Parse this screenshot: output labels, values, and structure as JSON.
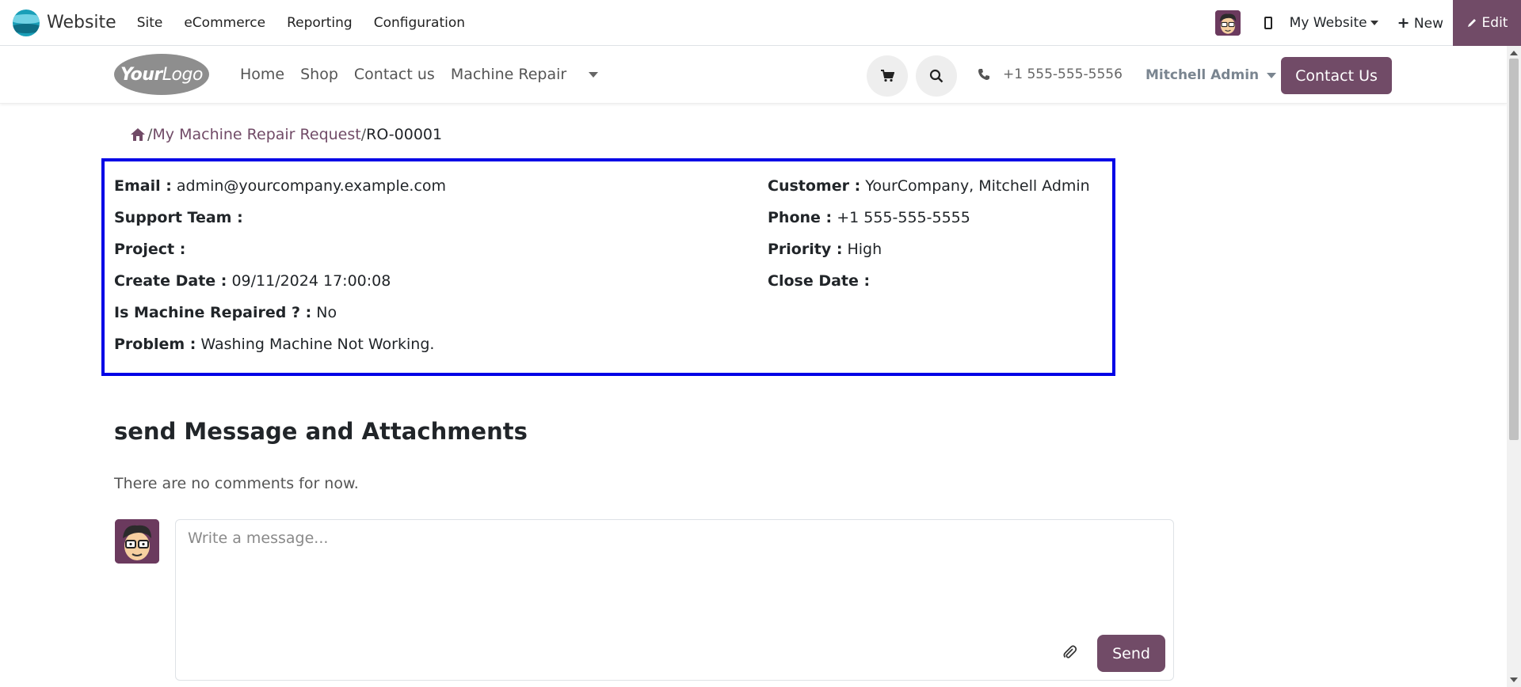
{
  "adminbar": {
    "app_name": "Website",
    "menu": [
      "Site",
      "eCommerce",
      "Reporting",
      "Configuration"
    ],
    "website_selector": "My Website",
    "new_label": "New",
    "edit_label": "Edit"
  },
  "header": {
    "logo_text_bold": "Your",
    "logo_text": "Logo",
    "nav": [
      "Home",
      "Shop",
      "Contact us",
      "Machine Repair"
    ],
    "phone": "+1 555-555-5556",
    "user": "Mitchell Admin",
    "contact_button": "Contact Us"
  },
  "breadcrumb": {
    "parent": "My Machine Repair Request",
    "separator": "/",
    "current": "RO-00001"
  },
  "details": {
    "email_label": "Email :",
    "email": "admin@yourcompany.example.com",
    "support_team_label": "Support Team :",
    "support_team": "",
    "project_label": "Project :",
    "project": "",
    "create_date_label": "Create Date :",
    "create_date": "09/11/2024 17:00:08",
    "repaired_label": "Is Machine Repaired ? :",
    "repaired": "No",
    "problem_label": "Problem :",
    "problem": "Washing Machine Not Working.",
    "customer_label": "Customer :",
    "customer": "YourCompany, Mitchell Admin",
    "phone_label": "Phone :",
    "phone": "+1 555-555-5555",
    "priority_label": "Priority :",
    "priority": "High",
    "close_date_label": "Close Date :",
    "close_date": ""
  },
  "messages": {
    "title": "send Message and Attachments",
    "empty_text": "There are no comments for now.",
    "placeholder": "Write a message...",
    "send_label": "Send"
  },
  "colors": {
    "brand": "#714b67",
    "highlight_border": "#0000e6"
  }
}
